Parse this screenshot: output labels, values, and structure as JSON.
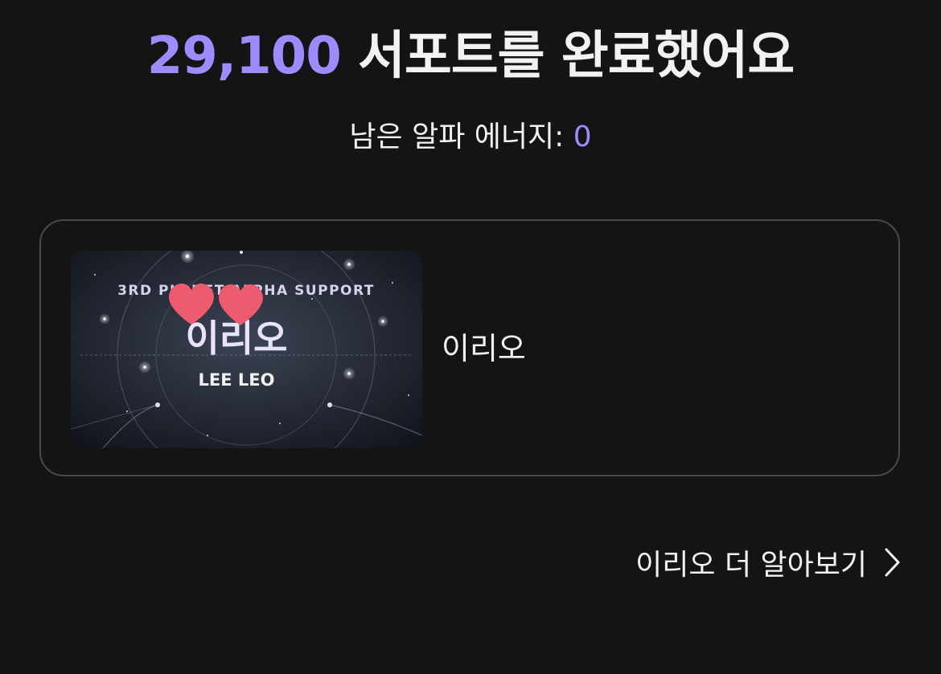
{
  "result": {
    "count": "29,100",
    "message": "서포트를 완료했어요"
  },
  "remaining": {
    "label": "남은 알파 에너지: ",
    "value": "0"
  },
  "support_card": {
    "banner_caption": "3RD PLANET ALPHA SUPPORT",
    "banner_title": "이리오",
    "banner_subtitle": "LEE LEO",
    "name": "이리오"
  },
  "more_link": {
    "label": "이리오 더 알아보기",
    "icon": "chevron-right-icon"
  },
  "colors": {
    "background": "#141414",
    "accent": "#9c8cff",
    "card_border": "#4a4a4e",
    "text": "#f2f2f2",
    "heart": "#ef5b6e"
  }
}
